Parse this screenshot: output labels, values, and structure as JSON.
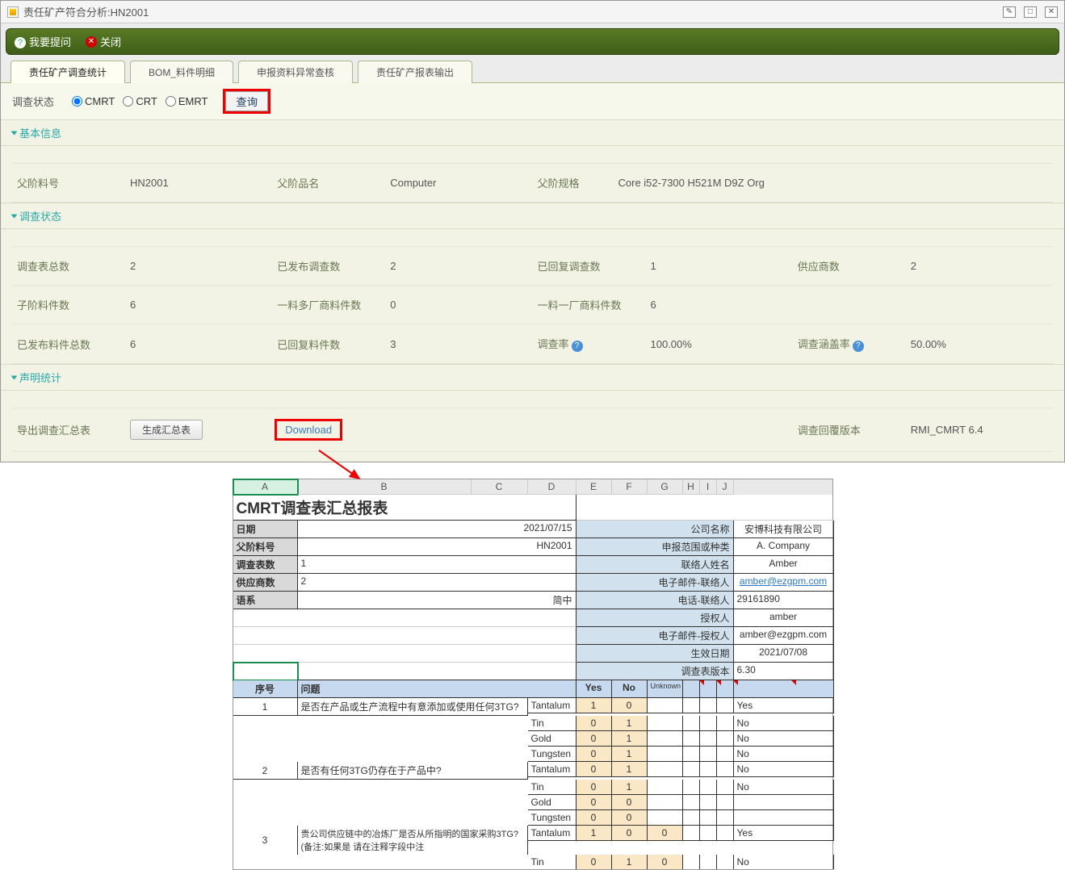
{
  "window": {
    "title": "责任矿产符合分析:HN2001"
  },
  "toolbar": {
    "ask": "我要提问",
    "close": "关闭"
  },
  "tabs": [
    "责任矿产调查统计",
    "BOM_料件明细",
    "申报资料异常查核",
    "责任矿产报表输出"
  ],
  "filter": {
    "label": "调查状态",
    "opt_cmrt": "CMRT",
    "opt_crt": "CRT",
    "opt_emrt": "EMRT",
    "query": "查询"
  },
  "sections": {
    "basic": "基本信息",
    "status": "调查状态",
    "stat": "声明统计"
  },
  "basic": {
    "parent_part_label": "父阶料号",
    "parent_part": "HN2001",
    "parent_name_label": "父阶品名",
    "parent_name": "Computer",
    "parent_spec_label": "父阶规格",
    "parent_spec": "Core i52-7300 H521M D9Z Org"
  },
  "status": {
    "r1": {
      "l1": "调查表总数",
      "v1": "2",
      "l2": "已发布调查数",
      "v2": "2",
      "l3": "已回复调查数",
      "v3": "1",
      "l4": "供应商数",
      "v4": "2"
    },
    "r2": {
      "l1": "子阶料件数",
      "v1": "6",
      "l2": "一料多厂商料件数",
      "v2": "0",
      "l3": "一料一厂商料件数",
      "v3": "6"
    },
    "r3": {
      "l1": "已发布料件总数",
      "v1": "6",
      "l2": "已回复料件数",
      "v2": "3",
      "l3": "调查率",
      "v3": "100.00%",
      "l4": "调查涵盖率",
      "v4": "50.00%"
    }
  },
  "export": {
    "label": "导出调查汇总表",
    "gen": "生成汇总表",
    "download": "Download",
    "version_label": "调查回覆版本",
    "version": "RMI_CMRT 6.4"
  },
  "sheet": {
    "title": "CMRT调查表汇总报表",
    "cols": [
      "A",
      "B",
      "C",
      "D",
      "E",
      "F",
      "G",
      "H",
      "I",
      "J"
    ],
    "info": {
      "date_l": "日期",
      "date_v": "2021/07/15",
      "part_l": "父阶料号",
      "part_v": "HN2001",
      "count_l": "调查表数",
      "count_v": "1",
      "supp_l": "供应商数",
      "supp_v": "2",
      "lang_l": "语系",
      "lang_v": "简中",
      "company_l": "公司名称",
      "company_v": "安博科技有限公司",
      "scope_l": "申报范围或种类",
      "scope_v": "A. Company",
      "contact_l": "联络人姓名",
      "contact_v": "Amber",
      "email_l": "电子邮件-联络人",
      "email_v": "amber@ezgpm.com",
      "phone_l": "电话-联络人",
      "phone_v": "29161890",
      "auth_l": "授权人",
      "auth_v": "amber",
      "authemail_l": "电子邮件-授权人",
      "authemail_v": "amber@ezgpm.com",
      "effdate_l": "生效日期",
      "effdate_v": "2021/07/08",
      "ver_l": "调查表版本",
      "ver_v": "6.30"
    },
    "qheader": {
      "seq": "序号",
      "question": "问题",
      "yes": "Yes",
      "no": "No",
      "unknown": "Unknown"
    },
    "metals": {
      "ta": "Tantalum",
      "sn": "Tin",
      "au": "Gold",
      "w": "Tungsten"
    },
    "answers": {
      "yes": "Yes",
      "no": "No"
    },
    "q1": {
      "num": "1",
      "text": "是否在产品或生产流程中有意添加或使用任何3TG?",
      "ta": {
        "y": "1",
        "n": "0",
        "ans": "Yes"
      },
      "sn": {
        "y": "0",
        "n": "1",
        "ans": "No"
      },
      "au": {
        "y": "0",
        "n": "1",
        "ans": "No"
      },
      "w": {
        "y": "0",
        "n": "1",
        "ans": "No"
      }
    },
    "q2": {
      "num": "2",
      "text": "是否有任何3TG仍存在于产品中?",
      "ta": {
        "y": "0",
        "n": "1",
        "ans": "No"
      },
      "sn": {
        "y": "0",
        "n": "1",
        "ans": "No"
      },
      "au": {
        "y": "0",
        "n": "0",
        "ans": ""
      },
      "w": {
        "y": "0",
        "n": "0",
        "ans": ""
      }
    },
    "q3": {
      "num": "3",
      "text": "贵公司供应链中的冶炼厂是否从所指明的国家采购3TG?(备注:如果是 请在注释字段中注",
      "ta": {
        "y": "1",
        "n": "0",
        "u": "0",
        "ans": "Yes"
      },
      "sn": {
        "y": "0",
        "n": "1",
        "u": "0",
        "ans": "No"
      }
    }
  }
}
